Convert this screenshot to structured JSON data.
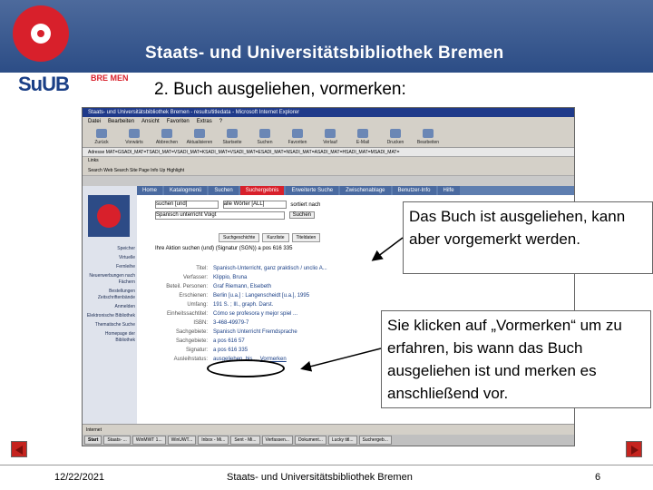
{
  "header": {
    "banner_title": "Staats- und Universitätsbibliothek Bremen",
    "logo_text": "SuUB",
    "logo_small": "BRE MEN"
  },
  "slide": {
    "heading": "2. Buch ausgeliehen, vormerken:"
  },
  "browser": {
    "window_title": "Staats- und Universitätsbibliothek Bremen - results/titledata - Microsoft Internet Explorer",
    "menu": [
      "Datei",
      "Bearbeiten",
      "Ansicht",
      "Favoriten",
      "Extras",
      "?"
    ],
    "toolbar": [
      "Zurück",
      "Vorwärts",
      "Abbrechen",
      "Aktualisieren",
      "Startseite",
      "Suchen",
      "Favoriten",
      "Verlauf",
      "E-Mail",
      "Drucken",
      "Bearbeiten"
    ],
    "address_label": "Adresse",
    "address_value": "MAT=GSADI_MAT=TSADI_MAT=VSADI_MAT=KSADI_MAT=VSADI_MAT=ESADI_MAT=NSADI_MAT=ASADI_MAT=HSADI_MAT=MSADI_MAT=",
    "links_label": "Links",
    "toolbar2_text": "Search Web  Search Site  Page Info  Up  Highlight",
    "status_text": "Internet"
  },
  "opac": {
    "nav_tabs": [
      "Home",
      "Katalogmenü",
      "Suchen",
      "Suchergebnis",
      "Erweiterte Suche",
      "Zwischenablage",
      "Benutzer-Info",
      "Hilfe"
    ],
    "active_tab": "Suchergebnis",
    "search_field_select": "suchen [und]",
    "search_scope_select": "alle Wörter [ALL]",
    "search_value": "Spanisch unterricht Voigt",
    "sort_label": "sortiert nach",
    "search_button": "Suchen",
    "result_tabs": [
      "Suchgeschichte",
      "Kurzliste",
      "Titeldaten"
    ],
    "left_links": [
      "Speicher",
      "Virtuelle",
      "Fernleihe",
      "Neuerwerbungen nach Fächern",
      "Bestellungen Zeitschriftenbände",
      "Anmelden",
      "Elektronische Bibliothek",
      "Thematische Suche",
      "Homepage der Bibliothek"
    ],
    "action_line": "Ihre Aktion  suchen (und) (Signatur (SGN)) a pos 616 335",
    "record": [
      {
        "label": "Titel:",
        "value": "Spanisch-Unterricht, ganz praktisch / unclio A..."
      },
      {
        "label": "Verfasser:",
        "value": "Klippio, Bruna"
      },
      {
        "label": "Beteil. Personen:",
        "value": "Graf Riemann, Elsebeth"
      },
      {
        "label": "Erschienen:",
        "value": "Berlin [u.a.] : Langenscheidt [u.a.], 1995"
      },
      {
        "label": "Umfang:",
        "value": "191 S. ; Ill., graph. Darst."
      },
      {
        "label": "Einheitssachtitel:",
        "value": "Cómo se profesora y mejor spiel ..."
      },
      {
        "label": "ISBN:",
        "value": "3-468-49979-7"
      },
      {
        "label": "Sachgebiete:",
        "value": "Spanisch Unterricht Fremdsprache"
      },
      {
        "label": "Sachgebiete:",
        "value": "a pos 616 57"
      },
      {
        "label": "Signatur:",
        "value": "a pos 616 335"
      },
      {
        "label": "Ausleihstatus:",
        "value": "ausgeliehen, bis ..."
      }
    ],
    "vormerken_link": "Vormerken"
  },
  "taskbar": [
    "Start",
    "Staats- ...",
    "WinMWT 1...",
    "WinUWT...",
    "Inbox - Mi...",
    "Sent - Mi...",
    "Verfassen...",
    "Dokument...",
    "Lucky titl...",
    "Suchergeb..."
  ],
  "callouts": {
    "borrowed": "Das Buch ist ausgeliehen, kann aber vorgemerkt werden.",
    "reserve": "Sie klicken auf „Vormerken“ um zu erfahren, bis wann das Buch ausgeliehen ist und merken es anschließend vor."
  },
  "footer": {
    "date": "12/22/2021",
    "center": "Staats- und Universitätsbibliothek Bremen",
    "page": "6"
  },
  "colors": {
    "banner": "#2c4d86",
    "brand_red": "#d8202b"
  }
}
